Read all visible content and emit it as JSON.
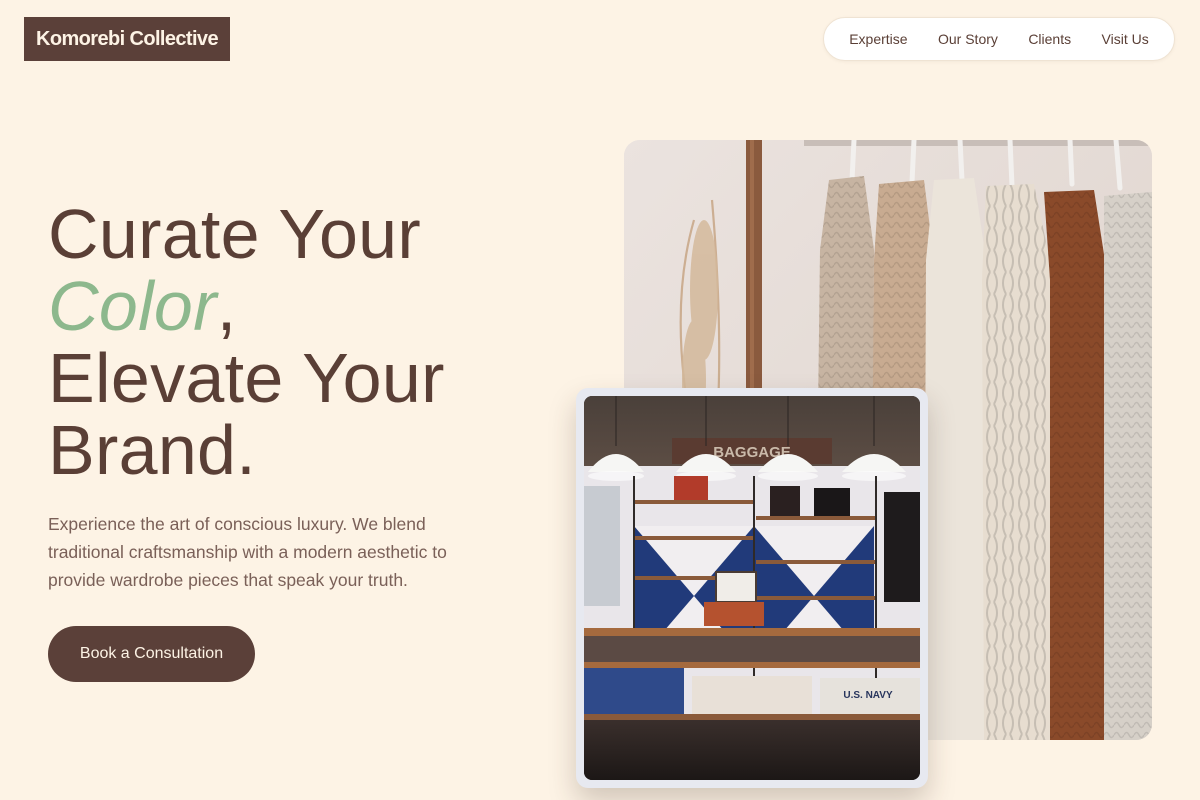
{
  "brand": {
    "name": "Komorebi Collective"
  },
  "nav": {
    "items": [
      {
        "label": "Expertise"
      },
      {
        "label": "Our Story"
      },
      {
        "label": "Clients"
      },
      {
        "label": "Visit Us"
      }
    ]
  },
  "hero": {
    "line1": "Curate Your",
    "accent_word": "Color",
    "accent_punct": ",",
    "line3": "Elevate Your",
    "line4": "Brand.",
    "lede": "Experience the art of conscious luxury. We blend traditional craftsmanship with a modern aesthetic to provide wardrobe pieces that speak your truth.",
    "cta_label": "Book a Consultation"
  },
  "images": {
    "rack_alt": "Knit sweaters hanging on a wooden clothing rack beside dried pampas grass",
    "store_alt": "Boutique store interior with pendant lamps and wooden shelves of folded garments",
    "store_sign": "BAGGAGE",
    "store_shirt_print": "U.S. NAVY"
  },
  "colors": {
    "background": "#fdf3e5",
    "primary_brown": "#5b4039",
    "accent_green": "#8db88d",
    "body_text": "#7a6058"
  }
}
